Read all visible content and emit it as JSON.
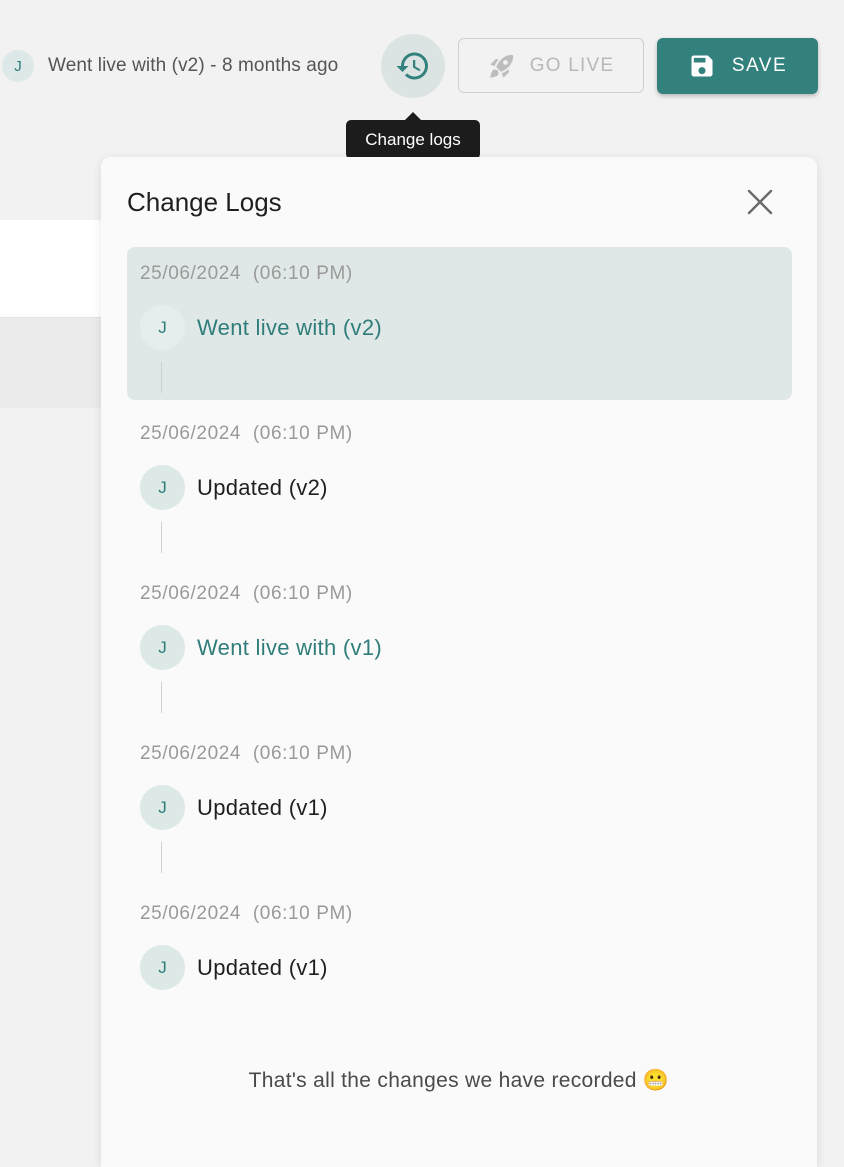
{
  "header": {
    "status_avatar": "J",
    "status_text": "Went live with (v2) - 8 months ago",
    "history_icon": "history-icon",
    "go_live_label": "GO LIVE",
    "go_live_icon": "rocket-icon",
    "save_label": "SAVE",
    "save_icon": "floppy-disk-icon"
  },
  "tooltip": "Change logs",
  "panel": {
    "title": "Change Logs",
    "close_icon": "close-icon",
    "entries": [
      {
        "date": "25/06/2024  (06:10 PM)",
        "avatar": "J",
        "text": "Went live with (v2)",
        "kind": "live",
        "active": true
      },
      {
        "date": "25/06/2024  (06:10 PM)",
        "avatar": "J",
        "text": "Updated (v2)",
        "kind": "update"
      },
      {
        "date": "25/06/2024  (06:10 PM)",
        "avatar": "J",
        "text": "Went live with (v1)",
        "kind": "live"
      },
      {
        "date": "25/06/2024  (06:10 PM)",
        "avatar": "J",
        "text": "Updated (v1)",
        "kind": "update"
      },
      {
        "date": "25/06/2024  (06:10 PM)",
        "avatar": "J",
        "text": "Updated (v1)",
        "kind": "update"
      }
    ],
    "footer": "That's all the changes we have recorded 😬"
  },
  "colors": {
    "accent": "#33817d",
    "accent_text": "#2f7d7a",
    "active_row": "#dfe8e7",
    "page_bg": "#f2f2f2"
  }
}
